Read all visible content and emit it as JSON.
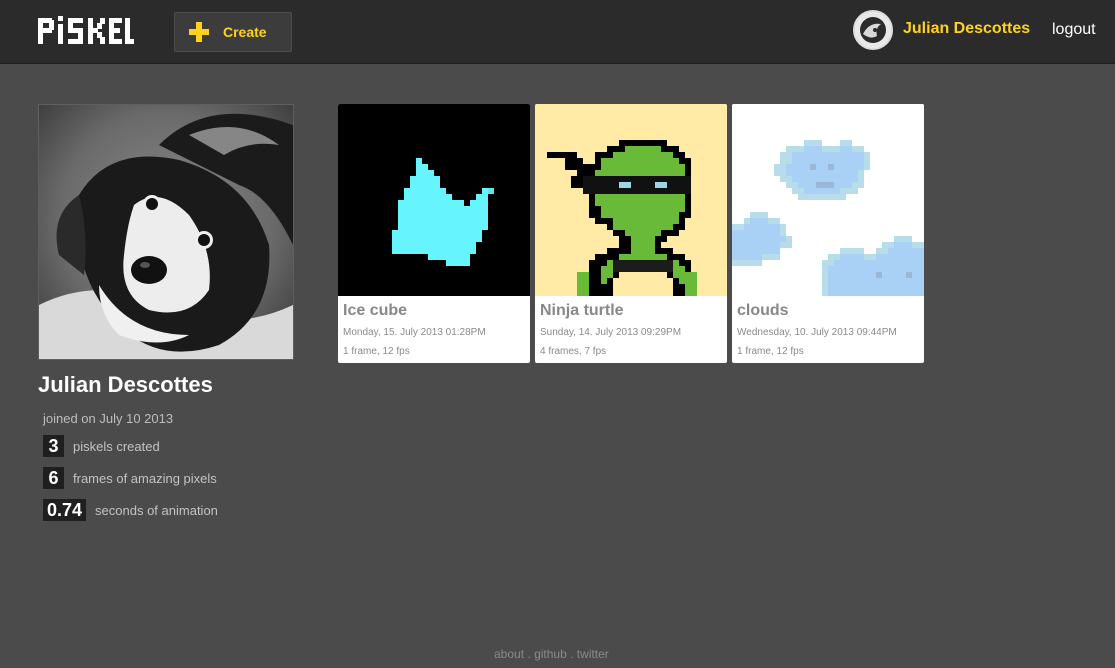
{
  "header": {
    "logo_text": "PISKEL",
    "create_label": "Create",
    "user_name": "Julian Descottes",
    "logout_label": "logout",
    "accent_color": "#ffd21f"
  },
  "profile": {
    "name": "Julian Descottes",
    "joined": "joined on July 10 2013",
    "stats": [
      {
        "value": "3",
        "label": "piskels created"
      },
      {
        "value": "6",
        "label": "frames of amazing pixels"
      },
      {
        "value": "0.74",
        "label": "seconds of animation"
      }
    ]
  },
  "piskels": [
    {
      "title": "Ice cube",
      "date": "Monday, 15. July 2013 01:28PM",
      "meta": "1 frame, 12 fps",
      "thumb": "ice-cube"
    },
    {
      "title": "Ninja turtle",
      "date": "Sunday, 14. July 2013 09:29PM",
      "meta": "4 frames, 7 fps",
      "thumb": "ninja-turtle"
    },
    {
      "title": "clouds",
      "date": "Wednesday, 10. July 2013 09:44PM",
      "meta": "1 frame, 12 fps",
      "thumb": "clouds"
    }
  ],
  "footer": {
    "links": [
      "about",
      "github",
      "twitter"
    ],
    "separator": "."
  }
}
